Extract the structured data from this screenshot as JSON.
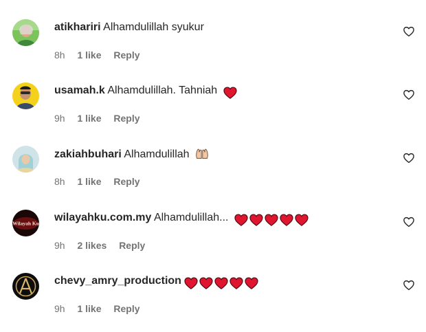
{
  "comments": [
    {
      "username": "atikhariri",
      "text": "Alhamdulillah syukur",
      "hearts": 0,
      "emoji": "",
      "time": "8h",
      "likes": "1 like",
      "reply": "Reply"
    },
    {
      "username": "usamah.k",
      "text": "Alhamdulillah. Tahniah",
      "hearts": 1,
      "emoji": "",
      "time": "9h",
      "likes": "1 like",
      "reply": "Reply"
    },
    {
      "username": "zakiahbuhari",
      "text": "Alhamdulillah",
      "hearts": 0,
      "emoji": "raising-hands",
      "time": "8h",
      "likes": "1 like",
      "reply": "Reply"
    },
    {
      "username": "wilayahku.com.my",
      "text": "Alhamdulillah...",
      "hearts": 5,
      "emoji": "",
      "time": "9h",
      "likes": "2 likes",
      "reply": "Reply",
      "avatar_text": "Wilayah Ku"
    },
    {
      "username": "chevy_amry_production",
      "text": "",
      "hearts": 5,
      "emoji": "",
      "time": "9h",
      "likes": "1 like",
      "reply": "Reply"
    }
  ],
  "colors": {
    "text": "#262626",
    "muted": "#737373",
    "heart": "#e0152f"
  },
  "icons": {
    "like": "heart-outline-icon",
    "emoji_heart": "red-heart-emoji"
  }
}
